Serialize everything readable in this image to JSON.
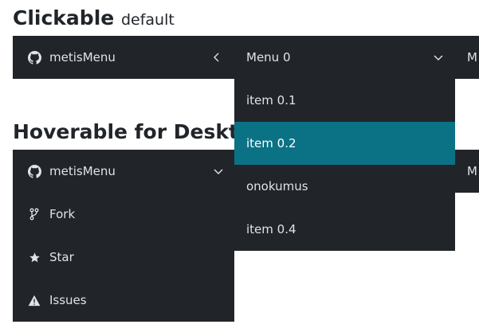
{
  "clickable": {
    "title": "Clickable",
    "subtitle": "default",
    "brand": "metisMenu",
    "menu0": "Menu 0",
    "right_clipped": "M"
  },
  "hoverable": {
    "title": "Hoverable for Desktop",
    "brand": "metisMenu",
    "right_clipped": "M",
    "items": [
      {
        "label": "Fork",
        "icon": "fork-icon"
      },
      {
        "label": "Star",
        "icon": "star-icon"
      },
      {
        "label": "Issues",
        "icon": "warning-icon"
      }
    ]
  },
  "dropdown": {
    "items": [
      {
        "label": "item 0.1",
        "active": false
      },
      {
        "label": "item 0.2",
        "active": true
      },
      {
        "label": "onokumus",
        "active": false
      },
      {
        "label": "item 0.4",
        "active": false
      }
    ]
  },
  "colors": {
    "bar_bg": "#212529",
    "active_bg": "#0b7285",
    "text": "#e1e3e5"
  }
}
